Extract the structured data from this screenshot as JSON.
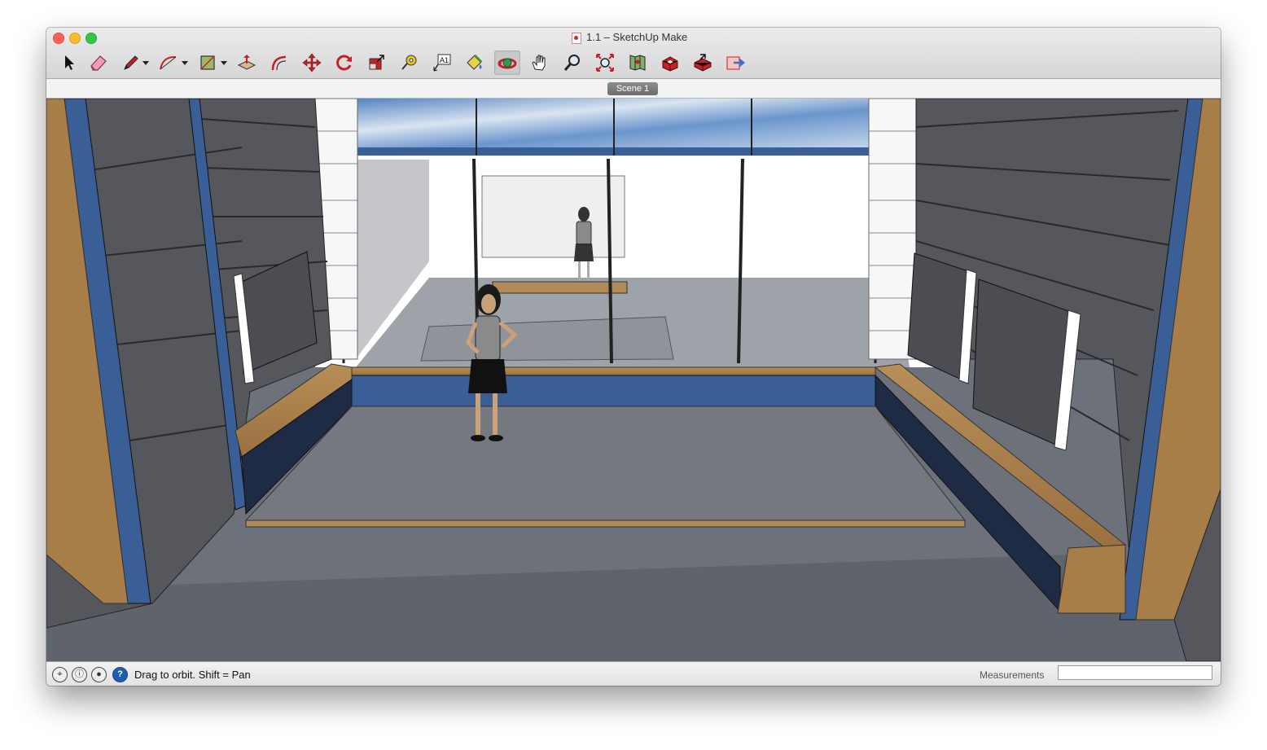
{
  "window": {
    "title": "1.1 – SketchUp Make"
  },
  "toolbar": {
    "tools": [
      {
        "name": "select-tool",
        "icon": "arrow-cursor-icon"
      },
      {
        "name": "eraser-tool",
        "icon": "eraser-icon"
      },
      {
        "name": "line-tool",
        "icon": "pencil-icon",
        "has_dropdown": true
      },
      {
        "name": "arc-tool",
        "icon": "arc-icon",
        "has_dropdown": true
      },
      {
        "name": "rectangle-tool",
        "icon": "rectangle-icon",
        "has_dropdown": true
      },
      {
        "name": "push-pull-tool",
        "icon": "push-pull-icon"
      },
      {
        "name": "offset-tool",
        "icon": "offset-icon"
      },
      {
        "name": "move-tool",
        "icon": "move-arrows-icon"
      },
      {
        "name": "rotate-tool",
        "icon": "rotate-icon"
      },
      {
        "name": "scale-tool",
        "icon": "scale-icon"
      },
      {
        "name": "tape-measure-tool",
        "icon": "tape-measure-icon"
      },
      {
        "name": "text-tool",
        "icon": "text-a1-icon"
      },
      {
        "name": "paint-bucket-tool",
        "icon": "paint-bucket-icon"
      },
      {
        "name": "orbit-tool",
        "icon": "orbit-icon",
        "active": true
      },
      {
        "name": "pan-tool",
        "icon": "hand-icon"
      },
      {
        "name": "zoom-tool",
        "icon": "magnifier-icon"
      },
      {
        "name": "zoom-extents-tool",
        "icon": "zoom-extents-icon"
      },
      {
        "name": "add-location-tool",
        "icon": "map-location-icon"
      },
      {
        "name": "3d-warehouse-tool",
        "icon": "warehouse-icon"
      },
      {
        "name": "share-model-tool",
        "icon": "share-model-icon"
      },
      {
        "name": "extension-warehouse-tool",
        "icon": "extension-icon"
      }
    ]
  },
  "scenes": {
    "tabs": [
      "Scene 1"
    ]
  },
  "status": {
    "hint": "Drag to orbit.  Shift = Pan",
    "measurements_label": "Measurements",
    "measurements_value": "",
    "icons": [
      "geo-location-icon",
      "credits-icon",
      "user-account-icon",
      "help-icon"
    ]
  },
  "colors": {
    "accent_blue": "#3a5f96",
    "wood": "#a77d48",
    "wall_grey": "#55575d",
    "floor_grey": "#6e727a"
  }
}
